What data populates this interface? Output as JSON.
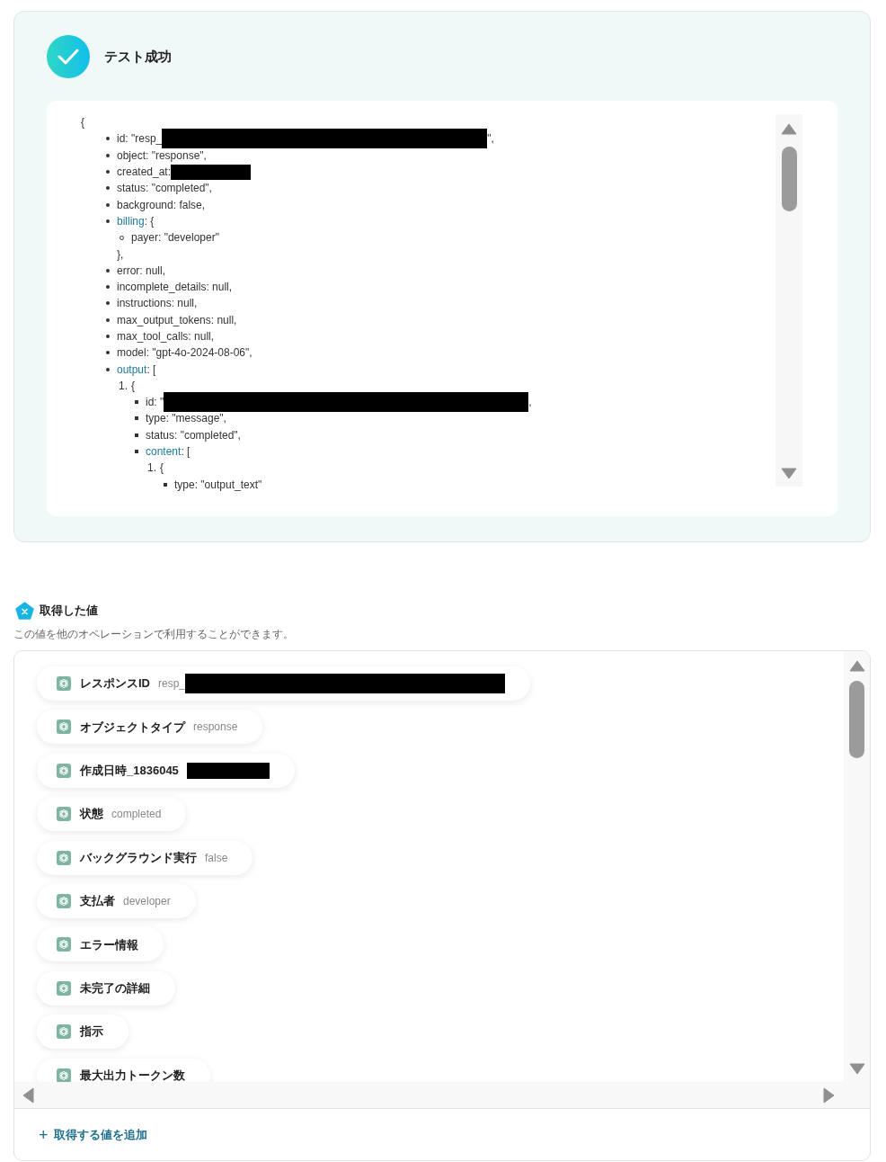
{
  "test_result": {
    "title": "テスト成功",
    "json_view": {
      "open": "{",
      "items": [
        {
          "kind": "disc",
          "text": "id: \"resp_",
          "redacted": true,
          "suffix": "\","
        },
        {
          "kind": "disc",
          "text": "object: \"response\","
        },
        {
          "kind": "disc",
          "text": "created_at:",
          "redacted": true
        },
        {
          "kind": "disc",
          "text": "status: \"completed\","
        },
        {
          "kind": "disc",
          "text": "background: false,"
        },
        {
          "kind": "disc",
          "key": "billing",
          "text": ": {",
          "children": [
            {
              "kind": "circle",
              "text": "payer: \"developer\""
            }
          ],
          "close": "},"
        },
        {
          "kind": "disc",
          "text": "error: null,"
        },
        {
          "kind": "disc",
          "text": "incomplete_details: null,"
        },
        {
          "kind": "disc",
          "text": "instructions: null,"
        },
        {
          "kind": "disc",
          "text": "max_output_tokens: null,"
        },
        {
          "kind": "disc",
          "text": "max_tool_calls: null,"
        },
        {
          "kind": "disc",
          "text": "model: \"gpt-4o-2024-08-06\","
        },
        {
          "kind": "disc",
          "key": "output",
          "text": ": [",
          "children": [
            {
              "kind": "number",
              "number": "1.",
              "text": "{",
              "children": [
                {
                  "kind": "square",
                  "text": "id: \"",
                  "redacted": true,
                  "suffix": ","
                },
                {
                  "kind": "square",
                  "text": "type: \"message\","
                },
                {
                  "kind": "square",
                  "text": "status: \"completed\","
                },
                {
                  "kind": "square",
                  "key": "content",
                  "text": ": [",
                  "children": [
                    {
                      "kind": "number",
                      "number": "1.",
                      "text": "{",
                      "children": [
                        {
                          "kind": "square",
                          "text": "type: \"output_text\""
                        }
                      ]
                    }
                  ]
                }
              ]
            }
          ]
        }
      ]
    }
  },
  "acquired_values": {
    "title": "取得した値",
    "description": "この値を他のオペレーションで利用することができます。",
    "chips": [
      {
        "label": "レスポンスID",
        "value": "resp_",
        "redacted": true
      },
      {
        "label": "オブジェクトタイプ",
        "value": "response"
      },
      {
        "label": "作成日時_1836045",
        "redacted": true
      },
      {
        "label": "状態",
        "value": "completed"
      },
      {
        "label": "バックグラウンド実行",
        "value": "false"
      },
      {
        "label": "支払者",
        "value": "developer"
      },
      {
        "label": "エラー情報"
      },
      {
        "label": "未完了の詳細"
      },
      {
        "label": "指示"
      },
      {
        "label": "最大出力トークン数"
      }
    ],
    "add_link": {
      "icon": "+",
      "label": "取得する値を追加"
    }
  }
}
